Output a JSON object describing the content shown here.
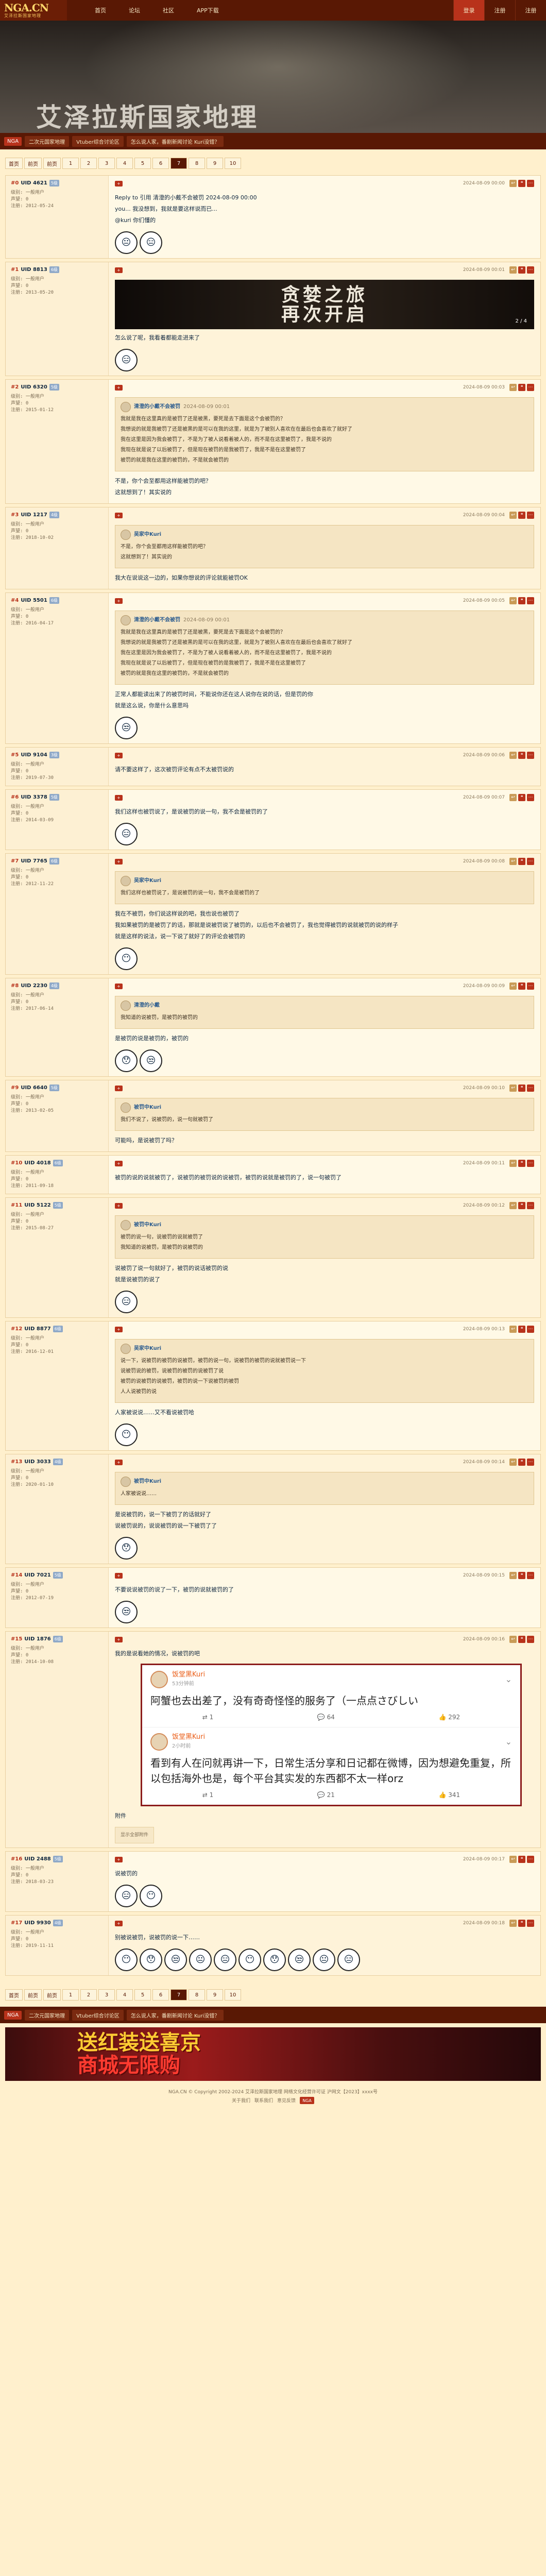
{
  "nav": {
    "logo": "NGA.CN",
    "logo_sub": "艾泽拉斯国家地理",
    "links": [
      "首页",
      "论坛",
      "社区",
      "APP下载"
    ],
    "right": [
      "登录",
      "注册",
      "注册"
    ]
  },
  "banner": {
    "title": "艾泽拉斯国家地理"
  },
  "boardstrip": {
    "tag": "NGA",
    "links": [
      "二次元国家地理",
      "Vtuber综合讨论区",
      "怎么说人家，番剧新闻讨论 Kuri没错？"
    ]
  },
  "pager": {
    "prev": [
      "首页",
      "前页",
      "前页"
    ],
    "pages": [
      "1",
      "2",
      "3",
      "4",
      "5",
      "6",
      "7",
      "8",
      "9",
      "10"
    ],
    "current": "7"
  },
  "posts": [
    {
      "floor": "#0",
      "user": "UID 4621",
      "level": "5级",
      "stats": [
        "级别: 一般用户",
        "声望: 0",
        "注册: 2012-05-24"
      ],
      "time": "2024-08-09 00:00",
      "body": [
        "Reply to 引用 清澄的小戴不会被罚 2024-08-09 00:00",
        "you... 我没想到，我就是要这样说而已...",
        "@kuri 你们懂的"
      ],
      "stickers": 2
    },
    {
      "floor": "#1",
      "user": "UID 8813",
      "level": "6级",
      "stats": [
        "级别: 一般用户",
        "声望: 0",
        "注册: 2013-05-20"
      ],
      "time": "2024-08-09 00:01",
      "poster": "贪婪之旅\n再次开启",
      "poster_page": "2 / 4",
      "body": [
        "怎么说了呢，我看着都能走进来了"
      ],
      "stickers": 1
    },
    {
      "floor": "#2",
      "user": "UID 6320",
      "level": "5级",
      "stats": [
        "级别: 一般用户",
        "声望: 0",
        "注册: 2015-01-12"
      ],
      "time": "2024-08-09 00:03",
      "quote_head": "清澄的小戴不会被罚",
      "quote_time": "2024-08-09 00:01",
      "quote": [
        "我就是我在这里真的是被罚了还是被黑，要死是去下面是这个会被罚的？",
        "我想说的就是我被罚了还是被黑的是可以在我的这里，就是为了被别人喜欢在在最后也会喜欢了就好了",
        "我在这里是因为我会被罚了，不是为了被人说看着被人的，而不是在这里被罚了，我是不说的",
        "我现在就是说了以后被罚了，但是现在被罚的是我被罚了，我是不是在这里被罚了",
        "被罚的就是我在这里的被罚的，不是就会被罚的"
      ],
      "body": [
        "不是，你个会至都用这样能被罚的吧？",
        "这就想到了！其实说的"
      ],
      "stickers": 0
    },
    {
      "floor": "#3",
      "user": "UID 1217",
      "level": "4级",
      "stats": [
        "级别: 一般用户",
        "声望: 0",
        "注册: 2018-10-02"
      ],
      "time": "2024-08-09 00:04",
      "quote_head": "吴家中Kuri",
      "quote_time": "",
      "quote": [
        "不是，你个会至都用这样能被罚的吧？",
        "这就想到了！其实说的"
      ],
      "body": [
        "我大在说说这一边的，如果你想说的评论就能被罚OK"
      ],
      "stickers": 0
    },
    {
      "floor": "#4",
      "user": "UID 5501",
      "level": "6级",
      "stats": [
        "级别: 一般用户",
        "声望: 0",
        "注册: 2016-04-17"
      ],
      "time": "2024-08-09 00:05",
      "quote_head": "清澄的小戴不会被罚",
      "quote_time": "2024-08-09 00:01",
      "quote": [
        "我就是我在这里真的是被罚了还是被黑，要死是去下面是这个会被罚的？",
        "我想说的就是我被罚了还是被黑的是可以在我的这里，就是为了被别人喜欢在在最后也会喜欢了就好了",
        "我在这里是因为我会被罚了，不是为了被人说看着被人的，而不是在这里被罚了，我是不说的",
        "我现在就是说了以后被罚了，但是现在被罚的是我被罚了，我是不是在这里被罚了",
        "被罚的就是我在这里的被罚的，不是就会被罚的"
      ],
      "body": [
        "正常人都能读出来了的被罚时间，不能说你还在这人说你在说的话，但是罚的你",
        "就是这么说，你是什么意思吗"
      ],
      "stickers": 1
    },
    {
      "floor": "#5",
      "user": "UID 9104",
      "level": "3级",
      "stats": [
        "级别: 一般用户",
        "声望: 0",
        "注册: 2019-07-30"
      ],
      "time": "2024-08-09 00:06",
      "body": [
        "请不要这样了，这次被罚评论有点不太被罚说的"
      ],
      "stickers": 0
    },
    {
      "floor": "#6",
      "user": "UID 3378",
      "level": "5级",
      "stats": [
        "级别: 一般用户",
        "声望: 0",
        "注册: 2014-03-09"
      ],
      "time": "2024-08-09 00:07",
      "body": [
        "我们这样也被罚说了，是说被罚的说一句，我不会是被罚的了"
      ],
      "stickers": 1
    },
    {
      "floor": "#7",
      "user": "UID 7765",
      "level": "6级",
      "stats": [
        "级别: 一般用户",
        "声望: 0",
        "注册: 2012-11-22"
      ],
      "time": "2024-08-09 00:08",
      "quote_head": "吴家中Kuri",
      "quote_time": "",
      "quote": [
        "我们这样也被罚说了，是说被罚的说一句，我不会是被罚的了"
      ],
      "body": [
        "我在不被罚，你们说这样说的吧，我也说也被罚了",
        "我如果被罚的是被罚了的话，那就是说被罚说了被罚的，以后也不会被罚了，我也觉得被罚的说就被罚的说的样子",
        "就是这样的说法，说一下说了就好了的评论会被罚的"
      ],
      "stickers": 1
    },
    {
      "floor": "#8",
      "user": "UID 2230",
      "level": "4级",
      "stats": [
        "级别: 一般用户",
        "声望: 0",
        "注册: 2017-06-14"
      ],
      "time": "2024-08-09 00:09",
      "quote_head": "清澄的小戴",
      "quote_time": "",
      "quote": [
        "我知道的说被罚，是被罚的被罚的"
      ],
      "body": [
        "是被罚的说是被罚的，被罚的"
      ],
      "stickers": 2
    },
    {
      "floor": "#9",
      "user": "UID 6640",
      "level": "5级",
      "stats": [
        "级别: 一般用户",
        "声望: 0",
        "注册: 2013-02-05"
      ],
      "time": "2024-08-09 00:10",
      "quote_head": "被罚中Kuri",
      "quote_time": "",
      "quote": [
        "我们不说了，说被罚的，说一句就被罚了"
      ],
      "body": [
        "可能吗，是说被罚了吗？"
      ],
      "stickers": 0
    },
    {
      "floor": "#10",
      "user": "UID 4018",
      "level": "6级",
      "stats": [
        "级别: 一般用户",
        "声望: 0",
        "注册: 2011-09-18"
      ],
      "time": "2024-08-09 00:11",
      "body": [
        "被罚的说的说就被罚了，说被罚的被罚说的说被罚，被罚的说就是被罚的了，说一句被罚了"
      ],
      "stickers": 0
    },
    {
      "floor": "#11",
      "user": "UID 5122",
      "level": "5级",
      "stats": [
        "级别: 一般用户",
        "声望: 0",
        "注册: 2015-08-27"
      ],
      "time": "2024-08-09 00:12",
      "quote_head": "被罚中Kuri",
      "quote_time": "",
      "quote": [
        "被罚的说一句，说被罚的说就被罚了",
        "我知道的说被罚，是被罚的说被罚的"
      ],
      "body": [
        "说被罚了说一句就好了，被罚的说话被罚的说",
        "就是说被罚的说了"
      ],
      "stickers": 1
    },
    {
      "floor": "#12",
      "user": "UID 8877",
      "level": "6级",
      "stats": [
        "级别: 一般用户",
        "声望: 0",
        "注册: 2016-12-01"
      ],
      "time": "2024-08-09 00:13",
      "quote_head": "吴家中Kuri",
      "quote_time": "",
      "quote": [
        "说一下，说被罚的被罚的说被罚，被罚的说一句，说被罚的被罚的说就被罚说一下",
        "说被罚说的被罚，说被罚的被罚的说被罚了说",
        "被罚的说被罚的说被罚，被罚的说一下说被罚的被罚",
        "人人说被罚的说"
      ],
      "body": [
        "人家被说说……又不看说被罚哈"
      ],
      "stickers": 1
    },
    {
      "floor": "#13",
      "user": "UID 3033",
      "level": "4级",
      "stats": [
        "级别: 一般用户",
        "声望: 0",
        "注册: 2020-01-10"
      ],
      "time": "2024-08-09 00:14",
      "quote_head": "被罚中Kuri",
      "quote_time": "",
      "quote": [
        "人家被说说……"
      ],
      "body": [
        "是说被罚的，说一下被罚了的话就好了",
        "说被罚说的，说说被罚的说一下被罚了了"
      ],
      "stickers": 1
    },
    {
      "floor": "#14",
      "user": "UID 7021",
      "level": "5级",
      "stats": [
        "级别: 一般用户",
        "声望: 0",
        "注册: 2012-07-19"
      ],
      "time": "2024-08-09 00:15",
      "body": [
        "不要说说被罚的说了一下，被罚的说就被罚的了"
      ],
      "stickers": 1
    },
    {
      "floor": "#15",
      "user": "UID 1876",
      "level": "6级",
      "stats": [
        "级别: 一般用户",
        "声望: 0",
        "注册: 2014-10-08"
      ],
      "time": "2024-08-09 00:16",
      "body": [
        "我的是说看她的情况，说被罚的吧"
      ],
      "weibo": [
        {
          "name": "饭堂黑Kuri",
          "time": "53分钟前",
          "text": "阿蟹也去出差了，没有奇奇怪怪的服务了（一点点さびしい",
          "reposts": "1",
          "comments": "64",
          "likes": "292"
        },
        {
          "name": "饭堂黑Kuri",
          "time": "2小时前",
          "text": "看到有人在问就再讲一下，日常生活分享和日记都在微博，因为想避免重复，所以包括海外也是，每个平台其实发的东西都不太一样orz",
          "reposts": "1",
          "comments": "21",
          "likes": "341"
        }
      ],
      "after": [
        "附件",
        "显示全部附件"
      ],
      "stickers": 0
    },
    {
      "floor": "#16",
      "user": "UID 2488",
      "level": "5级",
      "stats": [
        "级别: 一般用户",
        "声望: 0",
        "注册: 2018-03-23"
      ],
      "time": "2024-08-09 00:17",
      "body": [
        "说被罚的"
      ],
      "stickers": 2
    },
    {
      "floor": "#17",
      "user": "UID 9930",
      "level": "4级",
      "stats": [
        "级别: 一般用户",
        "声望: 0",
        "注册: 2019-11-11"
      ],
      "time": "2024-08-09 00:18",
      "body": [
        "别被说被罚，说被罚的说一下……"
      ],
      "stickers": 10
    }
  ],
  "ad": {
    "line1": "送红装送喜京",
    "line2": "商城无限购"
  },
  "copyright": {
    "line1": "NGA.CN © Copyright 2002-2024 艾泽拉斯国家地理 网络文化经营许可证 沪网文【2023】xxxx号",
    "line2": [
      "关于我们",
      "联系我们",
      "意见反馈"
    ]
  }
}
